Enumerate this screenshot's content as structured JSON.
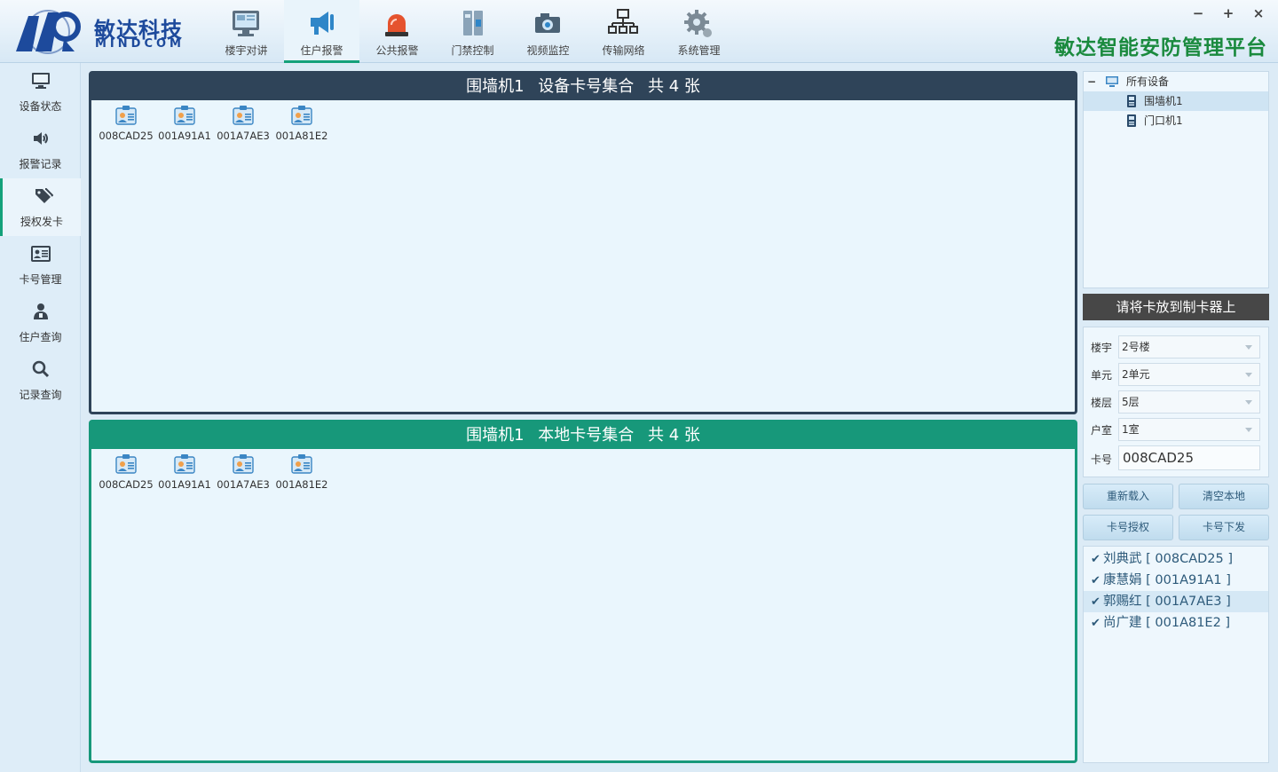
{
  "brand": {
    "name_cn": "敏达科技",
    "name_en": "MINDCOM"
  },
  "app_title": "敏达智能安防管理平台",
  "window_controls": {
    "minimize": "−",
    "maximize": "+",
    "close": "×"
  },
  "nav": [
    {
      "label": "楼宇对讲",
      "icon": "monitor-intercom-icon"
    },
    {
      "label": "住户报警",
      "icon": "megaphone-icon",
      "active": true
    },
    {
      "label": "公共报警",
      "icon": "alarm-siren-icon"
    },
    {
      "label": "门禁控制",
      "icon": "access-control-icon"
    },
    {
      "label": "视频监控",
      "icon": "camera-icon"
    },
    {
      "label": "传输网络",
      "icon": "network-icon"
    },
    {
      "label": "系统管理",
      "icon": "gears-icon"
    }
  ],
  "sidebar": [
    {
      "label": "设备状态",
      "icon": "monitor-icon"
    },
    {
      "label": "报警记录",
      "icon": "speaker-icon"
    },
    {
      "label": "授权发卡",
      "icon": "tags-icon",
      "active": true
    },
    {
      "label": "卡号管理",
      "icon": "id-card-icon"
    },
    {
      "label": "住户查询",
      "icon": "resident-icon"
    },
    {
      "label": "记录查询",
      "icon": "search-icon"
    }
  ],
  "device_panel": {
    "device": "围墙机1",
    "title": "设备卡号集合",
    "count_text": "共 4 张",
    "cards": [
      "008CAD25",
      "001A91A1",
      "001A7AE3",
      "001A81E2"
    ]
  },
  "local_panel": {
    "device": "围墙机1",
    "title": "本地卡号集合",
    "count_text": "共 4 张",
    "cards": [
      "008CAD25",
      "001A91A1",
      "001A7AE3",
      "001A81E2"
    ]
  },
  "device_tree": {
    "root": "所有设备",
    "children": [
      {
        "label": "围墙机1",
        "selected": true
      },
      {
        "label": "门口机1"
      }
    ]
  },
  "prompt": "请将卡放到制卡器上",
  "form": {
    "building": {
      "label": "楼宇",
      "value": "2号楼"
    },
    "unit": {
      "label": "单元",
      "value": "2单元"
    },
    "floor": {
      "label": "楼层",
      "value": "5层"
    },
    "room": {
      "label": "户室",
      "value": "1室"
    },
    "card": {
      "label": "卡号",
      "value": "008CAD25"
    }
  },
  "buttons": {
    "reload": "重新载入",
    "clear_local": "清空本地",
    "authorize": "卡号授权",
    "issue": "卡号下发"
  },
  "residents": [
    {
      "name": "刘典武",
      "card": "008CAD25",
      "checked": true
    },
    {
      "name": "康慧娟",
      "card": "001A91A1",
      "checked": true
    },
    {
      "name": "郭赐红",
      "card": "001A7AE3",
      "checked": true,
      "selected": true
    },
    {
      "name": "尚广建",
      "card": "001A81E2",
      "checked": true
    }
  ],
  "colors": {
    "device_panel_header": "#2f4459",
    "local_panel_header": "#17987a",
    "accent_green": "#14a17a",
    "title_green": "#1a8a3e",
    "brand_blue": "#1d4a9c"
  }
}
